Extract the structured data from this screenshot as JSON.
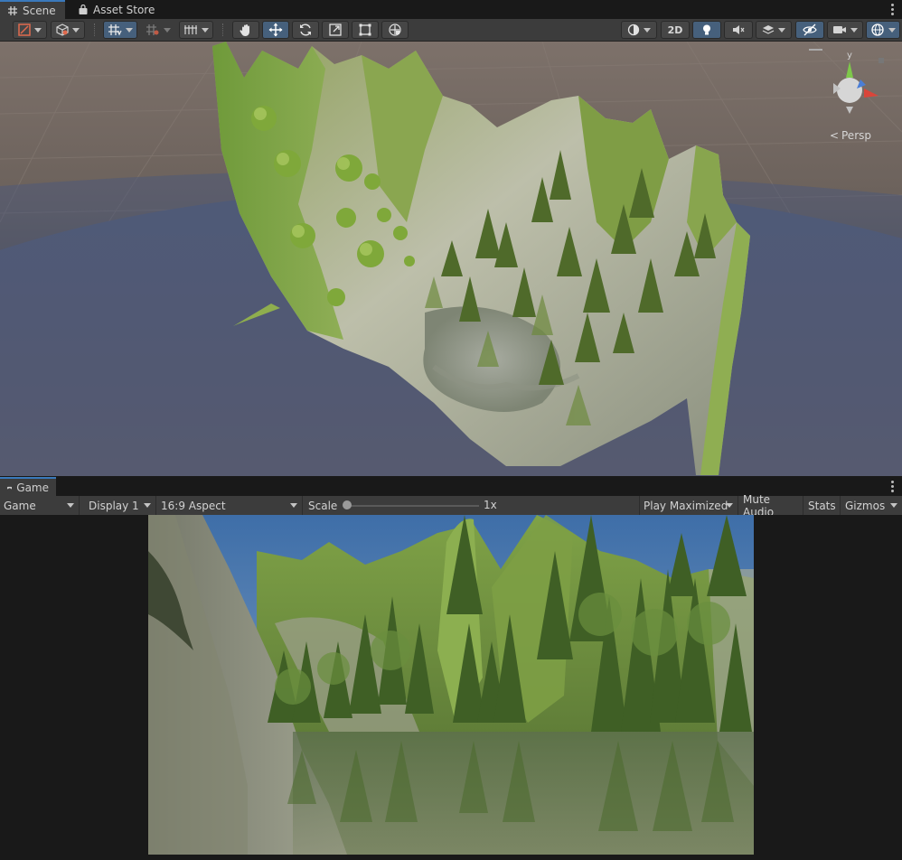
{
  "scene_tabs": [
    {
      "label": "Scene",
      "active": true,
      "icon": "grid-icon"
    },
    {
      "label": "Asset Store",
      "active": false,
      "icon": "store-bag-icon"
    }
  ],
  "toolbar": {
    "two_d_label": "2D",
    "tools": [
      "hand-tool",
      "move-tool",
      "rotate-tool",
      "scale-tool",
      "rect-tool",
      "transform-tool"
    ],
    "active_tool": "move-tool"
  },
  "gizmo": {
    "label": "Persp",
    "axis_y": "y"
  },
  "game_tab": {
    "label": "Game",
    "icon": "gamepad-icon"
  },
  "game_toolbar": {
    "view": "Game",
    "display": "Display 1",
    "aspect": "16:9 Aspect",
    "scale_label": "Scale",
    "scale_value": "1x",
    "play_maximized": "Play Maximized",
    "mute_audio": "Mute Audio",
    "stats": "Stats",
    "gizmos": "Gizmos"
  },
  "colors": {
    "accent": "#3a79bb",
    "panel": "#3c3c3c",
    "background": "#191919"
  }
}
